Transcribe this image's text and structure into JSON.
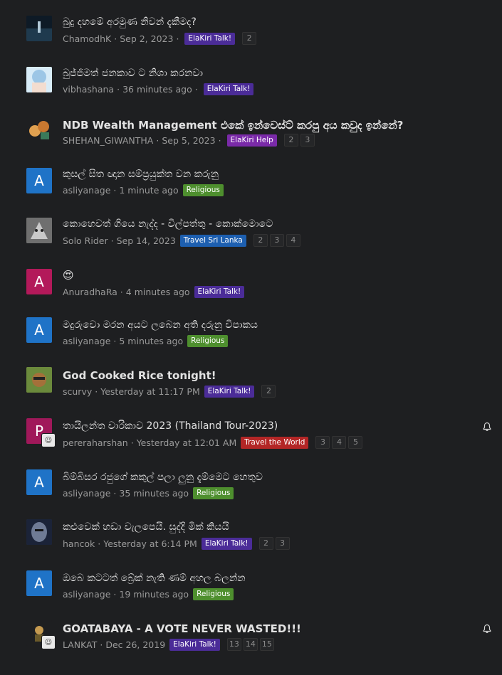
{
  "threads": [
    {
      "title": "බුදු දහමේ අරමුණ නිවන් දැකීමද?",
      "author": "ChamodhK",
      "date": "Sep 2, 2023",
      "forum": "ElaKiri Talk!",
      "badge": "talk",
      "pages": [
        "2"
      ],
      "avatar": "img",
      "avatar_color": "#1a2a3a",
      "bold": false
    },
    {
      "title": "බුජ්ජිමත් ජනකාව ට නිශා කරනවා",
      "author": "vibhashana",
      "date": "36 minutes ago",
      "forum": "ElaKiri Talk!",
      "badge": "talk",
      "pages": [],
      "avatar": "img",
      "avatar_color": "#bcd9ef",
      "bold": false
    },
    {
      "title": "NDB Wealth Management එකේ ඉන්වෙස්ට් කරපු අය කවුද ඉන්නේ?",
      "author": "SHEHAN_GIWANTHA",
      "date": "Sep 5, 2023",
      "forum": "ElaKiri Help",
      "badge": "help",
      "pages": [
        "2",
        "3"
      ],
      "avatar": "img",
      "avatar_color": "#c88a3a",
      "bold": true
    },
    {
      "title": "කුසල් සිත ඥාන සම්ප්‍රයුක්ත වන කරුනු",
      "author": "asliyanage",
      "date": "1 minute ago",
      "forum": "Religious",
      "badge": "religious",
      "pages": [],
      "avatar": "A",
      "avatar_color": "#1f73c7",
      "bold": false
    },
    {
      "title": "කොහෙවත් ගියෙ නැද්ද - විල්පත්තු - කොක්මොටෙ",
      "author": "Solo Rider",
      "date": "Sep 14, 2023",
      "forum": "Travel Sri Lanka",
      "badge": "travel-sl",
      "pages": [
        "2",
        "3",
        "4"
      ],
      "avatar": "img",
      "avatar_color": "#8c8c8c",
      "bold": false
    },
    {
      "title": "😍",
      "author": "AnuradhaRa",
      "date": "4 minutes ago",
      "forum": "ElaKiri Talk!",
      "badge": "talk",
      "pages": [],
      "avatar": "A",
      "avatar_color": "#b3195a",
      "bold": false
    },
    {
      "title": "මදුරුවො මරන අයට ලබෙන අති දරුනු විපාකය",
      "author": "asliyanage",
      "date": "5 minutes ago",
      "forum": "Religious",
      "badge": "religious",
      "pages": [],
      "avatar": "A",
      "avatar_color": "#1f73c7",
      "bold": false
    },
    {
      "title": "God Cooked Rice tonight!",
      "author": "scurvy",
      "date": "Yesterday at 11:17 PM",
      "forum": "ElaKiri Talk!",
      "badge": "talk",
      "pages": [
        "2"
      ],
      "avatar": "img",
      "avatar_color": "#8b6a3c",
      "bold": true
    },
    {
      "title": "තායිලන්ත චාරිකාව 2023 (Thailand Tour-2023)",
      "author": "pereraharshan",
      "date": "Yesterday at 12:01 AM",
      "forum": "Travel the World",
      "badge": "travel-world",
      "pages": [
        "3",
        "4",
        "5"
      ],
      "avatar": "P",
      "avatar_color": "#a0185a",
      "bold": false,
      "bell": true
    },
    {
      "title": "බිම්බිසර රජුගේ කකුල් පලා ලුනු දැම්මෙට හෙතුව",
      "author": "asliyanage",
      "date": "35 minutes ago",
      "forum": "Religious",
      "badge": "religious",
      "pages": [],
      "avatar": "A",
      "avatar_color": "#1f73c7",
      "bold": false
    },
    {
      "title": "කළුවෙක් හඩා වැලපෙයි. සුද්දි මික් කියයි",
      "author": "hancok",
      "date": "Yesterday at 6:14 PM",
      "forum": "ElaKiri Talk!",
      "badge": "talk",
      "pages": [
        "2",
        "3"
      ],
      "avatar": "img",
      "avatar_color": "#2b3550",
      "bold": false
    },
    {
      "title": "ඔබෙ කටටත් බ්‍රේක් නැති ණම් අහල බලන්න",
      "author": "asliyanage",
      "date": "19 minutes ago",
      "forum": "Religious",
      "badge": "religious",
      "pages": [],
      "avatar": "A",
      "avatar_color": "#1f73c7",
      "bold": false
    },
    {
      "title": "GOATABAYA - A VOTE NEVER WASTED!!!",
      "author": "LANKAT",
      "date": "Dec 26, 2019",
      "forum": "ElaKiri Talk!",
      "badge": "talk",
      "pages": [
        "13",
        "14",
        "15"
      ],
      "avatar": "img",
      "avatar_color": "#5a4a2a",
      "bold": true,
      "bell": true
    }
  ]
}
